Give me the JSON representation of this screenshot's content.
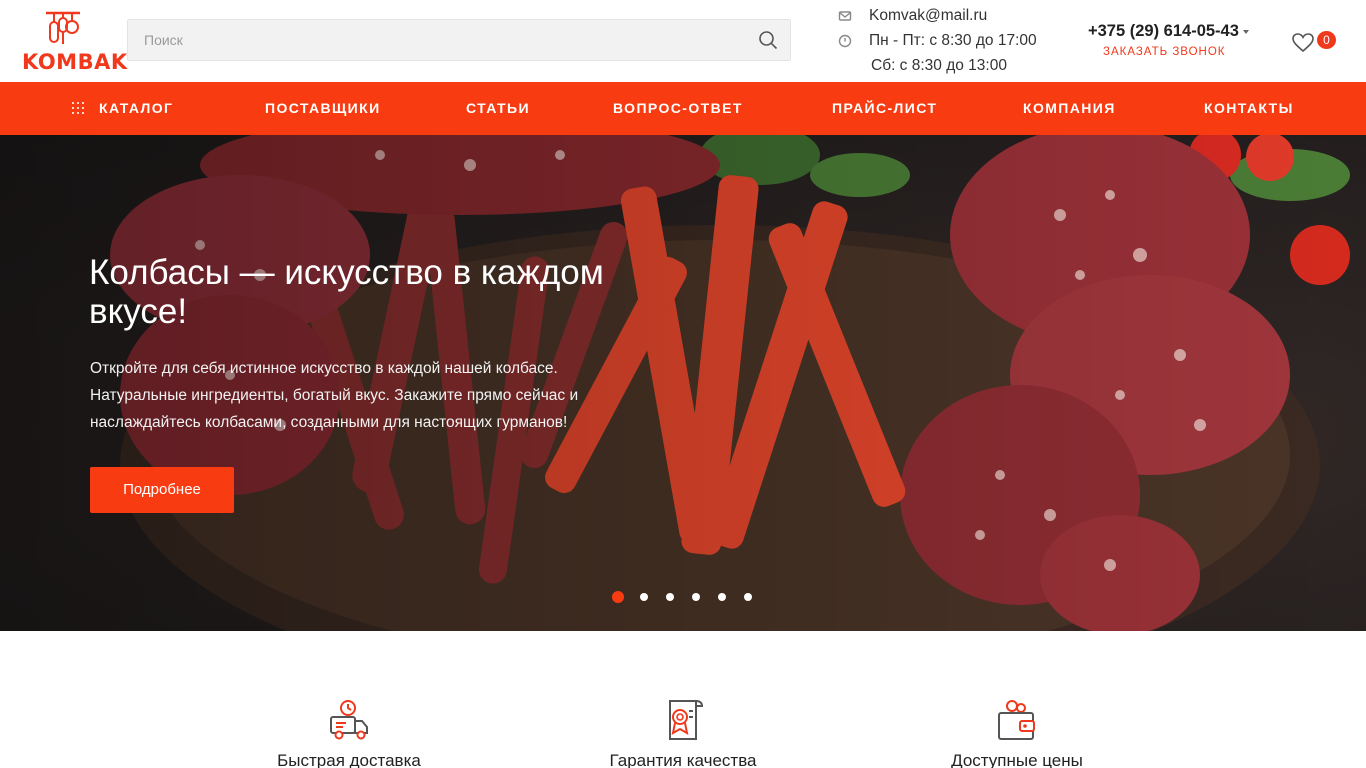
{
  "brand": {
    "logo_text": "KOMBAK",
    "accent_color": "#f93b12"
  },
  "search": {
    "placeholder": "Поиск",
    "icon": "search-icon"
  },
  "contacts": {
    "email": "Komvak@mail.ru",
    "hours_weekdays": "Пн - Пт: с 8:30 до 17:00",
    "hours_saturday": "Сб: с 8:30 до 13:00",
    "phone": "+375 (29) 614-05-43",
    "callback_label": "Заказать звонок"
  },
  "favorites": {
    "count": "0",
    "icon": "heart-icon"
  },
  "nav": {
    "items": [
      {
        "label": "Каталог"
      },
      {
        "label": "Поставщики"
      },
      {
        "label": "Статьи"
      },
      {
        "label": "Вопрос-ответ"
      },
      {
        "label": "Прайс-лист"
      },
      {
        "label": "Компания"
      },
      {
        "label": "Контакты"
      }
    ]
  },
  "hero": {
    "title": "Колбасы — искусство в каждом вкусе!",
    "text": "Откройте для себя истинное искусство в каждой нашей колбасе. Натуральные ингредиенты, богатый вкус. Закажите прямо сейчас и наслаждайтесь колбасами, созданными для настоящих гурманов!",
    "button_label": "Подробнее",
    "slides_count": 6,
    "active_slide": 1
  },
  "features": [
    {
      "label": "Быстрая доставка",
      "icon": "delivery-truck-icon"
    },
    {
      "label": "Гарантия качества",
      "icon": "quality-certificate-icon"
    },
    {
      "label": "Доступные цены",
      "icon": "wallet-icon"
    }
  ]
}
